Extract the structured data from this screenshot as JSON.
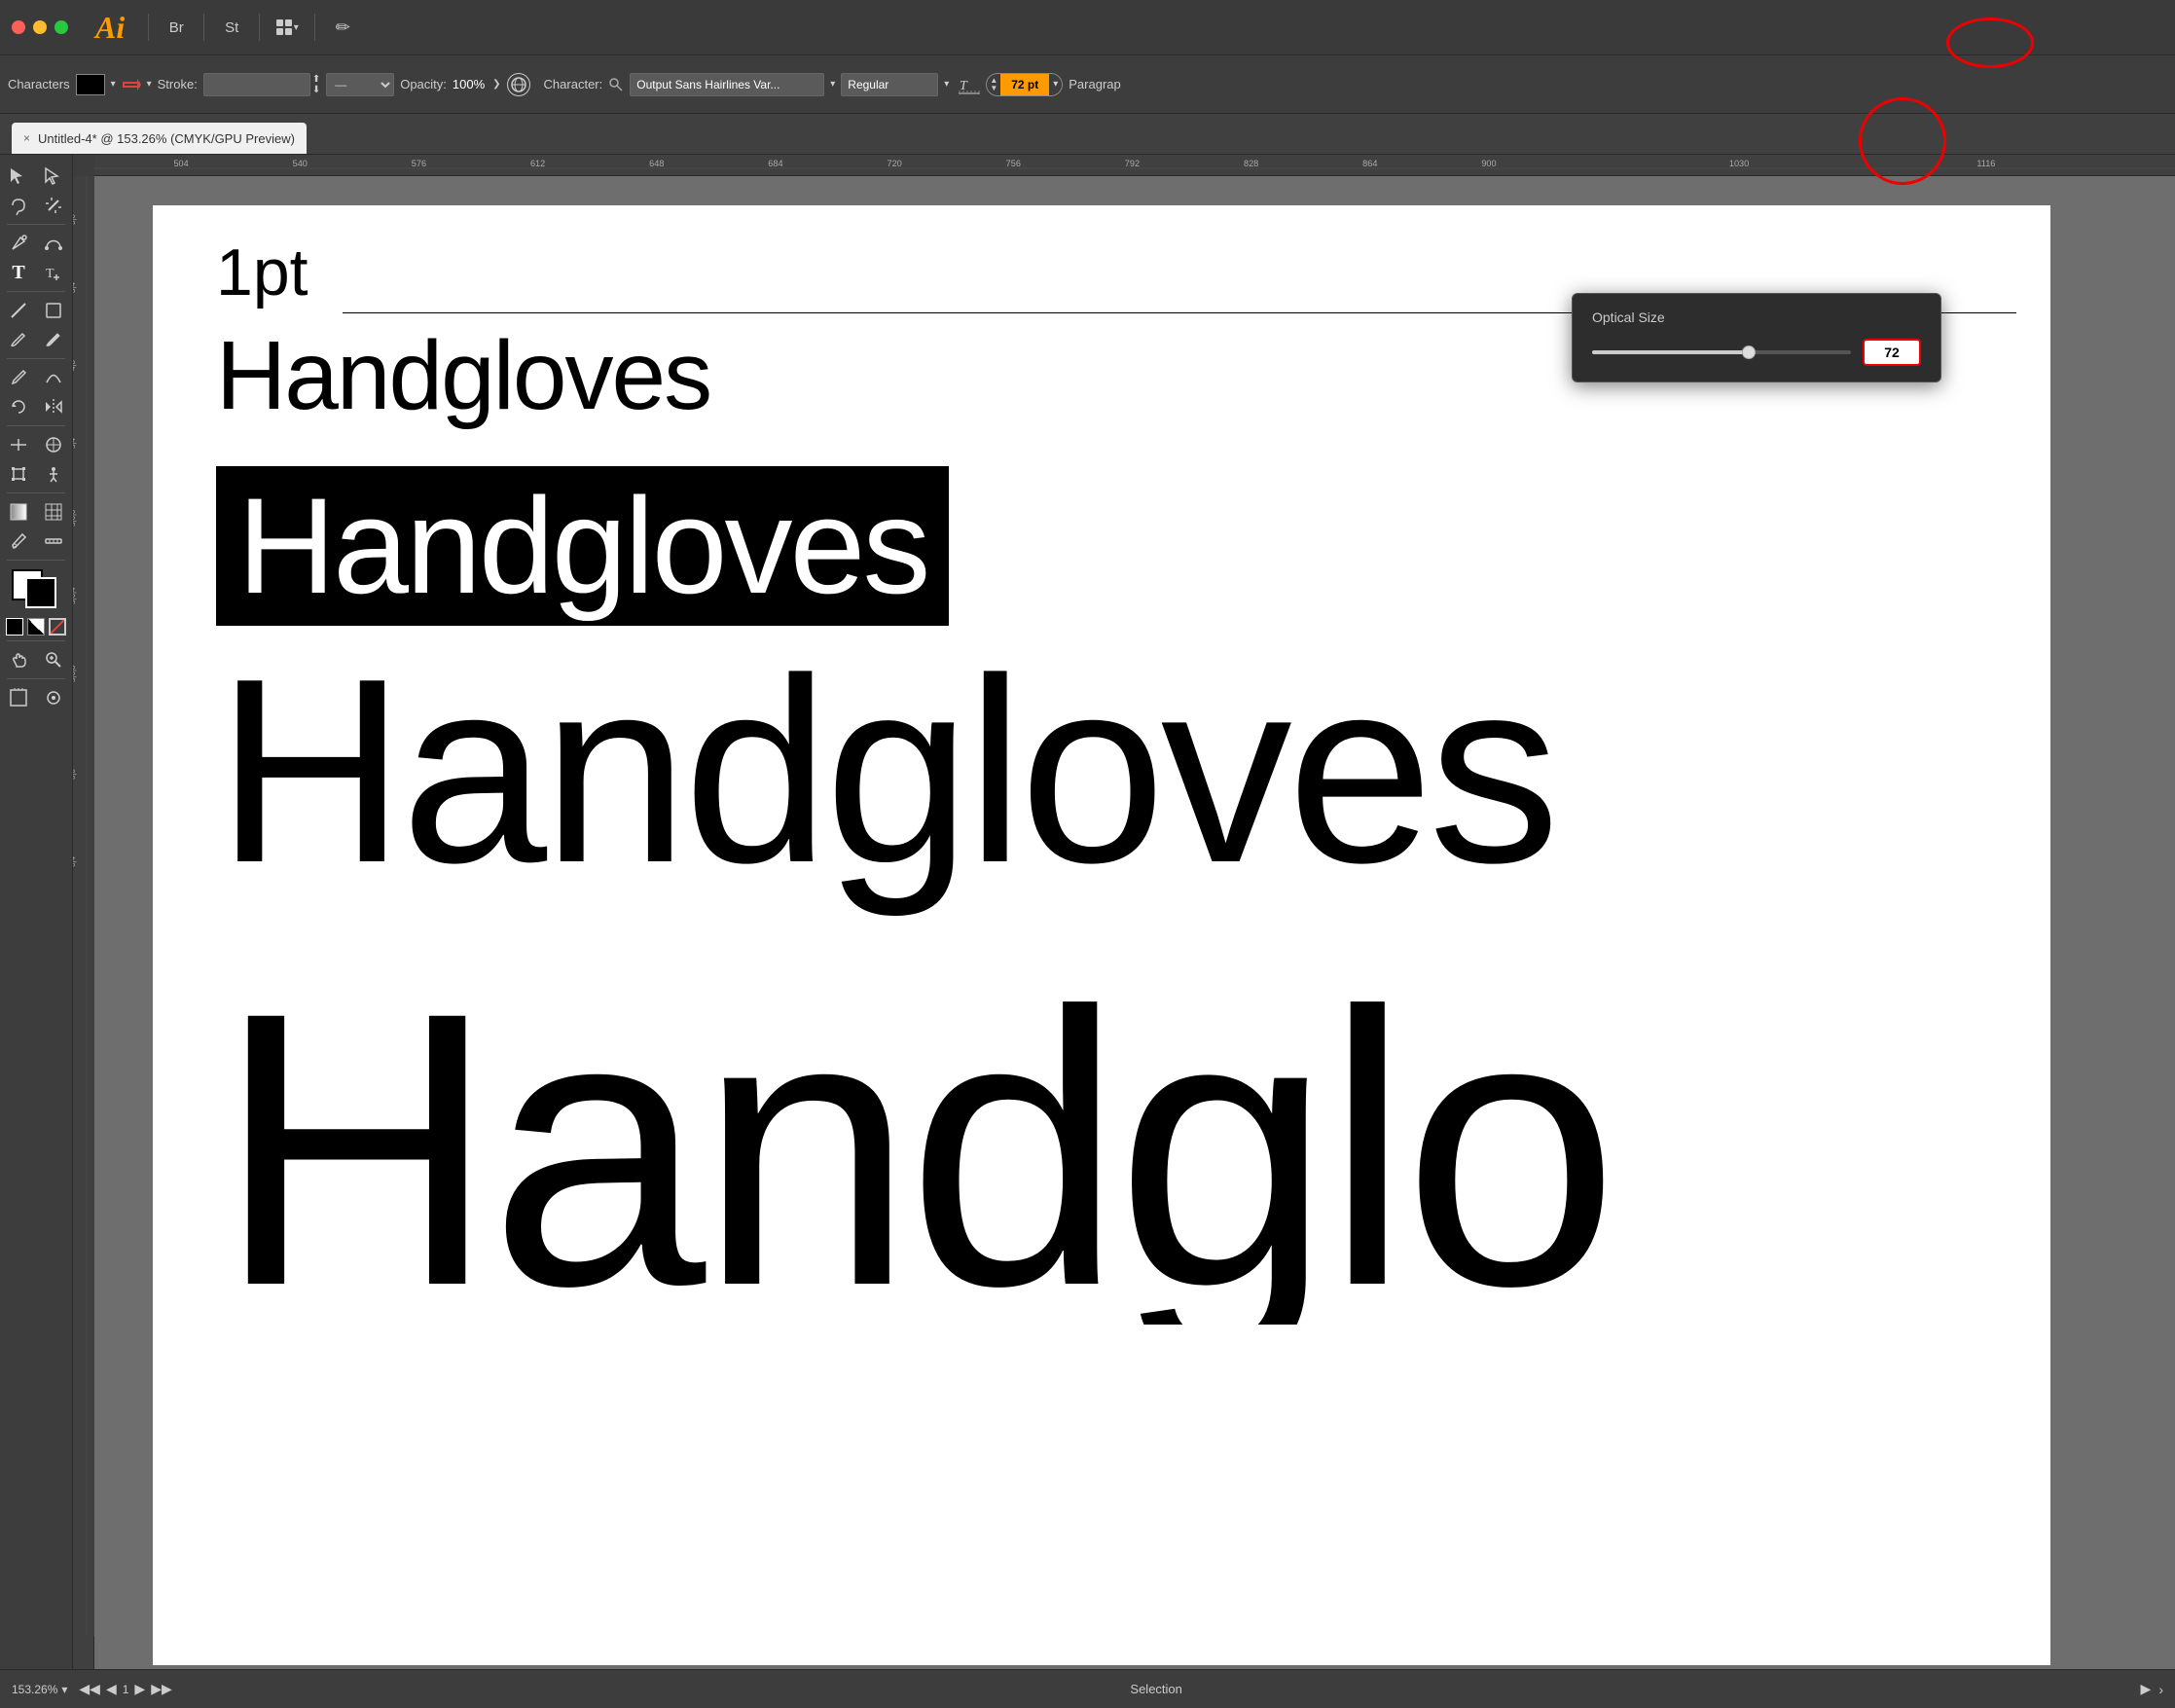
{
  "app": {
    "logo": "Ai",
    "title": "Adobe Illustrator"
  },
  "titlebar": {
    "bridge_label": "Br",
    "stock_label": "St",
    "dropdown_icon": "▾",
    "pen_icon": "✏"
  },
  "toolbar": {
    "characters_label": "Characters",
    "fill_label": "",
    "stroke_label": "Stroke:",
    "opacity_label": "Opacity:",
    "opacity_value": "100%",
    "character_label": "Character:",
    "font_name": "Output Sans Hairlines Var...",
    "font_style": "Regular",
    "font_size": "72 pt",
    "font_size_numeric": "72",
    "paragraph_label": "Paragrap"
  },
  "tab": {
    "close_icon": "×",
    "title": "Untitled-4* @ 153.26% (CMYK/GPU Preview)"
  },
  "optical_size": {
    "title": "Optical Size",
    "value": "72",
    "slider_pct": 60
  },
  "rulers": {
    "h_marks": [
      "504",
      "540",
      "576",
      "612",
      "648",
      "684",
      "720",
      "756",
      "792",
      "828",
      "864",
      "900",
      "1030",
      "1116"
    ],
    "v_marks": [
      "3|0",
      "3|4",
      "4|8",
      "5|4",
      "5|6|0",
      "5|6|4",
      "5|6|8",
      "5|7|2",
      "6|0",
      "6|4",
      "6|5",
      "6|7|2",
      "7|0|2",
      "7|0|6"
    ]
  },
  "canvas": {
    "text_1pt": "1pt",
    "text_handgloves_sm": "Handgloves",
    "text_handgloves_inv": "Handgloves",
    "text_handgloves_lg": "Handgloves",
    "text_handgloves_xl": "Handglo"
  },
  "status_bar": {
    "zoom": "153.26%",
    "zoom_icon": "▾",
    "prev_icon": "◀",
    "prev2_icon": "◀",
    "page": "1",
    "next_icon": "▶",
    "next2_icon": "▶",
    "mode": "Selection",
    "play_icon": "▶",
    "arrow_right": "›"
  },
  "left_tools": [
    {
      "name": "selection-tool",
      "icon": "↖",
      "interactable": true
    },
    {
      "name": "direct-selection-tool",
      "icon": "↗",
      "interactable": true
    },
    {
      "name": "lasso-tool",
      "icon": "⌇",
      "interactable": true
    },
    {
      "name": "wand-tool",
      "icon": "✦",
      "interactable": true
    },
    {
      "name": "pen-tool",
      "icon": "✒",
      "interactable": true
    },
    {
      "name": "type-tool",
      "icon": "T",
      "interactable": true
    },
    {
      "name": "line-tool",
      "icon": "╲",
      "interactable": true
    },
    {
      "name": "shape-tool",
      "icon": "□",
      "interactable": true
    },
    {
      "name": "paintbrush-tool",
      "icon": "🖌",
      "interactable": true
    },
    {
      "name": "pencil-tool",
      "icon": "✏",
      "interactable": true
    },
    {
      "name": "rotate-tool",
      "icon": "↻",
      "interactable": true
    },
    {
      "name": "mirror-tool",
      "icon": "⇔",
      "interactable": true
    },
    {
      "name": "width-tool",
      "icon": "⇿",
      "interactable": true
    },
    {
      "name": "puppet-tool",
      "icon": "⊕",
      "interactable": true
    },
    {
      "name": "gradient-tool",
      "icon": "▦",
      "interactable": true
    },
    {
      "name": "mesh-tool",
      "icon": "⊞",
      "interactable": true
    },
    {
      "name": "eyedropper-tool",
      "icon": "💉",
      "interactable": true
    },
    {
      "name": "chart-tool",
      "icon": "📊",
      "interactable": true
    },
    {
      "name": "artboard-tool",
      "icon": "⊓",
      "interactable": true
    },
    {
      "name": "hand-tool",
      "icon": "✋",
      "interactable": true
    },
    {
      "name": "zoom-tool",
      "icon": "🔍",
      "interactable": true
    }
  ],
  "colors": {
    "app_bg": "#3d3d3d",
    "canvas_bg": "#6e6e6e",
    "artboard_bg": "#ffffff",
    "accent_orange": "#ff9a00",
    "highlight_red": "#e00000"
  }
}
